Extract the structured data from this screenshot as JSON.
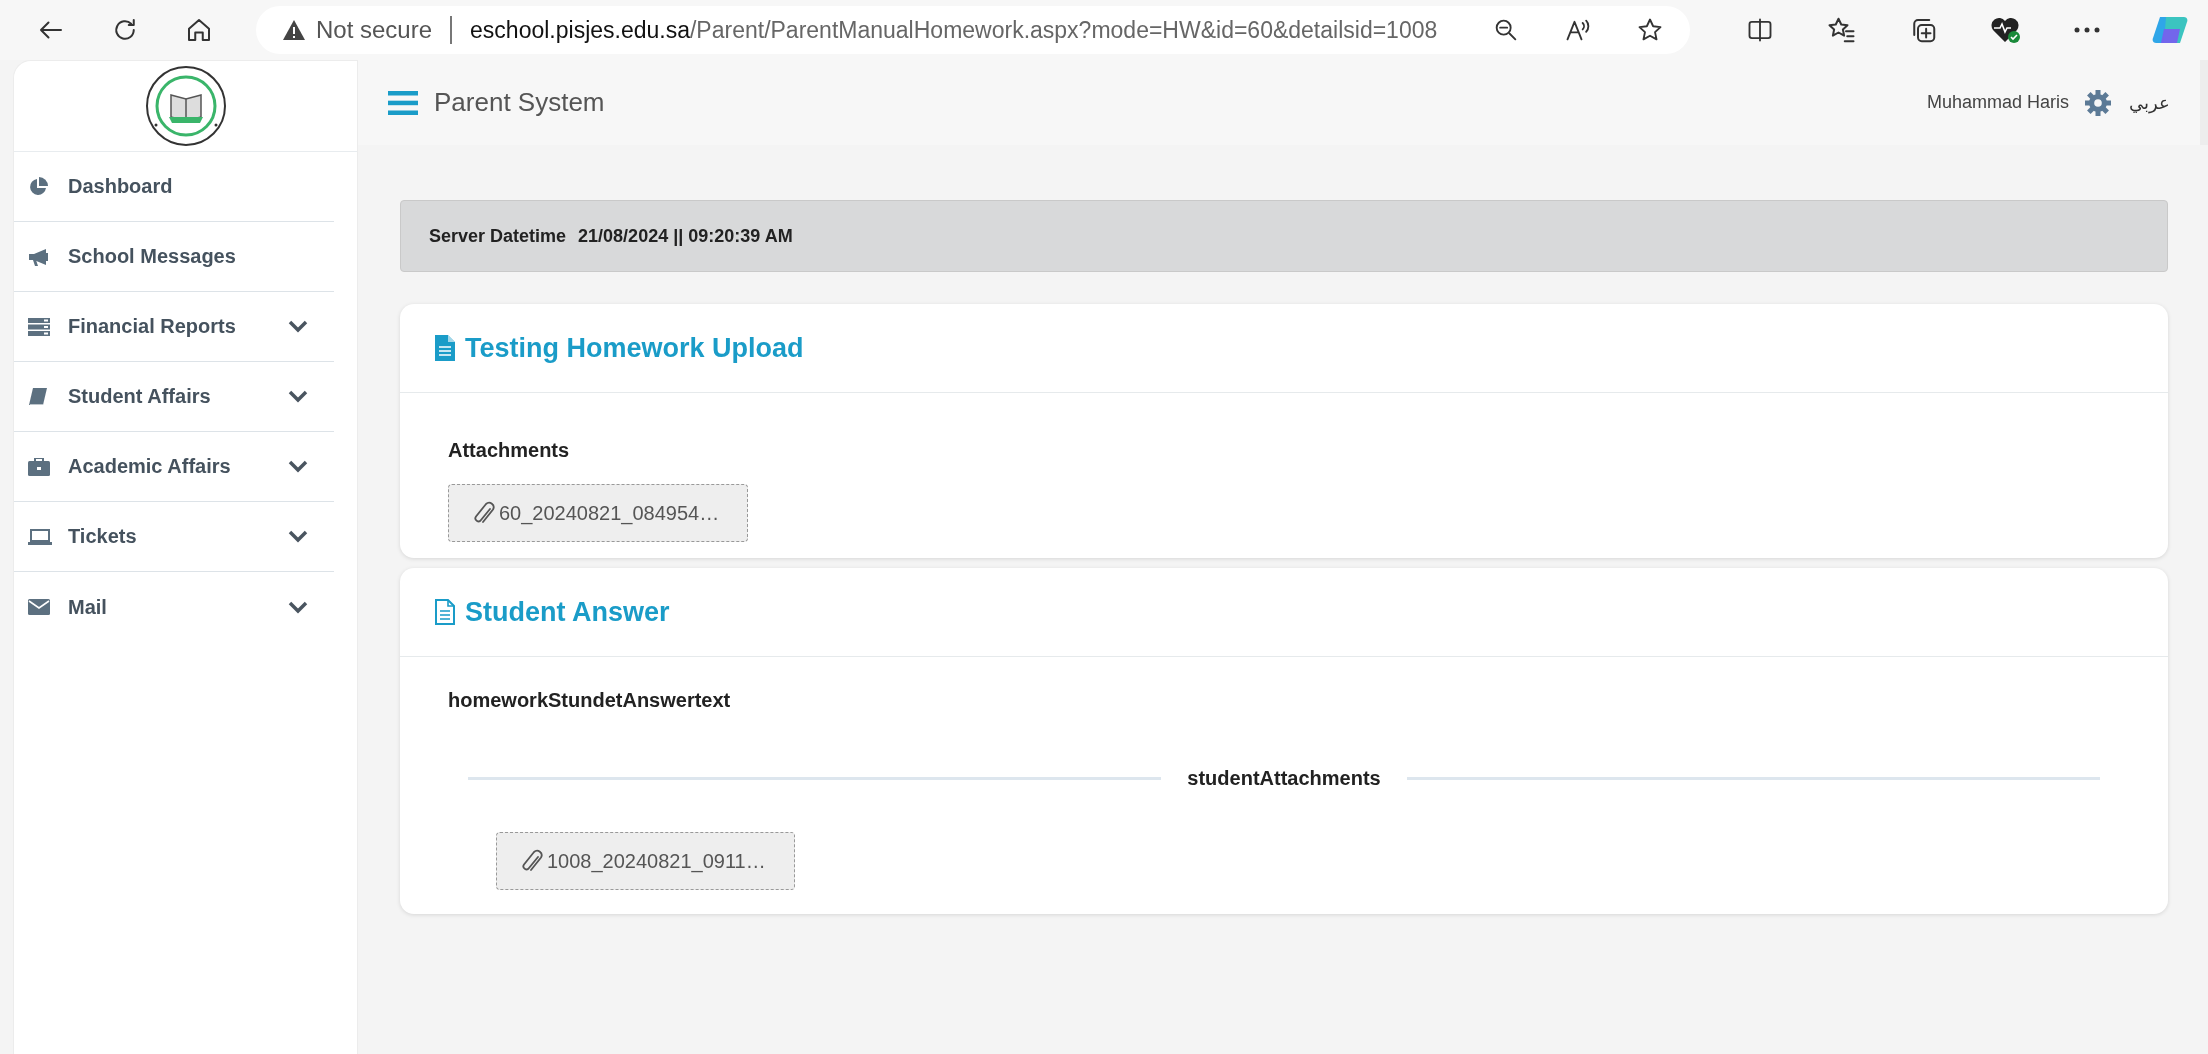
{
  "browser": {
    "security": "Not secure",
    "url_host": "eschool.pisjes.edu.sa",
    "url_path": "/Parent/ParentManualHomework.aspx?mode=HW&id=60&detailsid=1008"
  },
  "sidebar": {
    "items": [
      {
        "label": "Dashboard",
        "expandable": false
      },
      {
        "label": "School Messages",
        "expandable": false
      },
      {
        "label": "Financial Reports",
        "expandable": true
      },
      {
        "label": "Student Affairs",
        "expandable": true
      },
      {
        "label": "Academic Affairs",
        "expandable": true
      },
      {
        "label": "Tickets",
        "expandable": true
      },
      {
        "label": "Mail",
        "expandable": true
      }
    ]
  },
  "header": {
    "title": "Parent System",
    "user": "Muhammad Haris",
    "language": "عربي"
  },
  "server_datetime": {
    "label": "Server Datetime",
    "value": "21/08/2024 || 09:20:39 AM"
  },
  "homework": {
    "title": "Testing Homework Upload",
    "attachments_label": "Attachments",
    "attachments": [
      "60_20240821_084954…"
    ]
  },
  "student_answer": {
    "title": "Student Answer",
    "answer_text": "homeworkStundetAnswertext",
    "attachments_label": "studentAttachments",
    "attachments": [
      "1008_20240821_0911…"
    ]
  }
}
